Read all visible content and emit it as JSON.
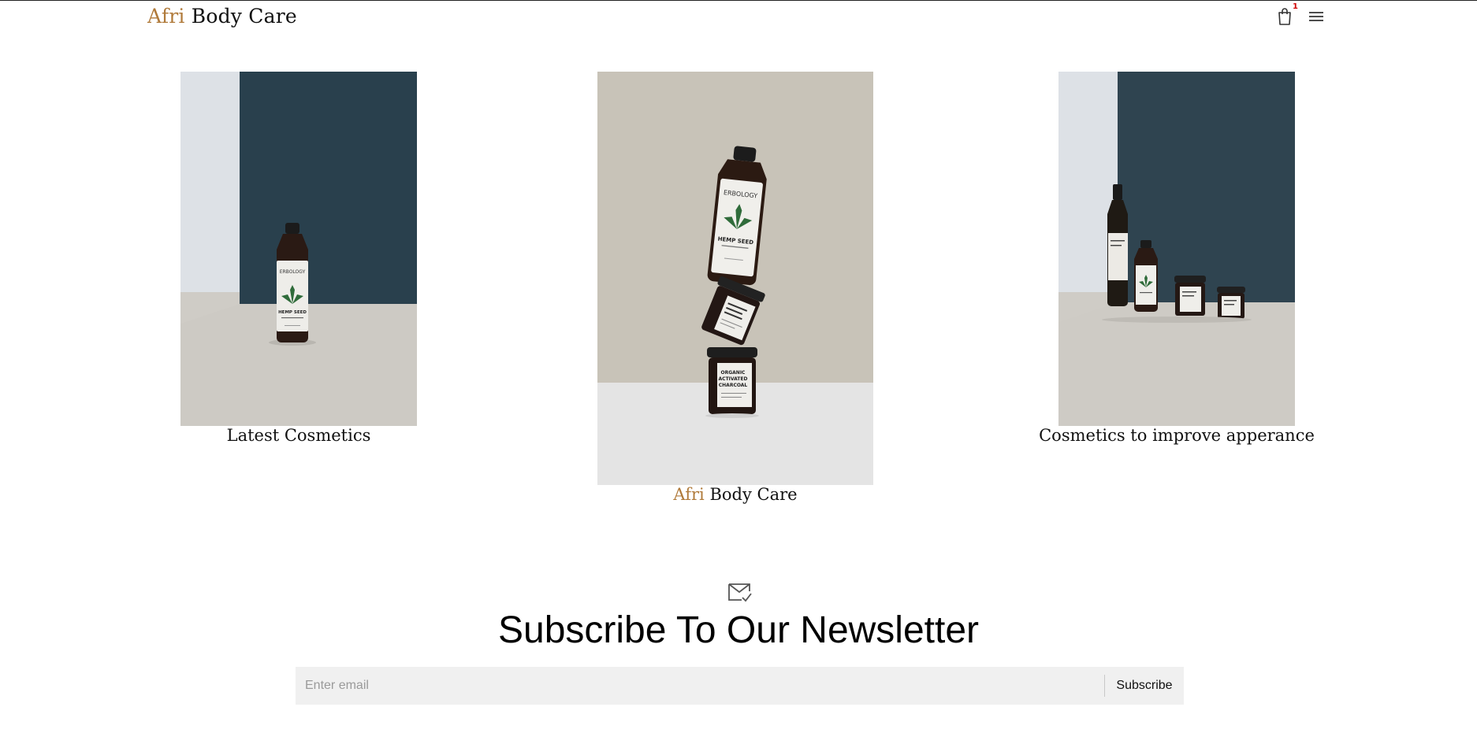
{
  "header": {
    "logo_accent": "Afri",
    "logo_rest": "Body Care",
    "cart_count": "1",
    "cart_icon": "shopping-bag-icon",
    "menu_icon": "hamburger-menu-icon"
  },
  "products": [
    {
      "caption": "Latest Cosmetics"
    },
    {
      "caption_accent": "Afri",
      "caption_rest": "Body Care"
    },
    {
      "caption": "Cosmetics to improve apperance"
    }
  ],
  "newsletter": {
    "icon": "mail-check-icon",
    "title": "Subscribe To Our Newsletter",
    "email_placeholder": "Enter email",
    "email_value": "",
    "submit_label": "Subscribe"
  },
  "bottle_labels": {
    "brand": "ERBOLOGY",
    "product": "HEMP SEED",
    "product_2": "ORGANIC ACTIVATED CHARCOAL"
  },
  "colors": {
    "accent": "#b07a3a",
    "badge": "#d10000",
    "form_bg": "#f0f0f0",
    "wall_dark": "#2b3f4c"
  }
}
